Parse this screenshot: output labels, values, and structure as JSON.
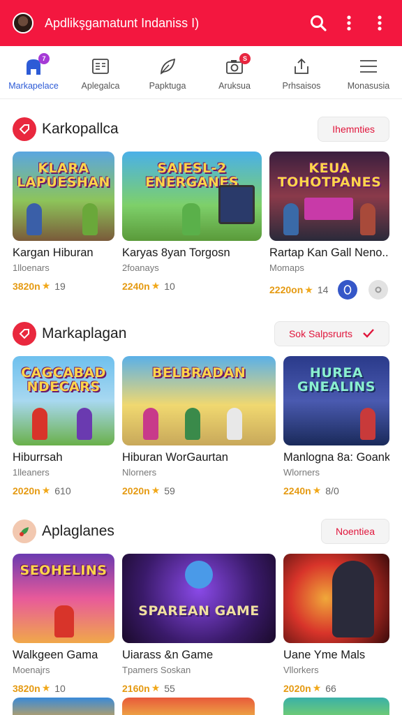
{
  "appbar": {
    "title": "Apdlikşgamatunt Indaniss I)",
    "icons": [
      "avatar",
      "search-icon",
      "more-vertical-icon",
      "more-vertical-icon"
    ],
    "color": "#f3173f"
  },
  "tabs": [
    {
      "label": "Markapelace",
      "icon": "store-icon",
      "active": true,
      "badge": "7"
    },
    {
      "label": "Aplegalca",
      "icon": "list-icon",
      "active": false
    },
    {
      "label": "Papktuga",
      "icon": "leaf-icon",
      "active": false
    },
    {
      "label": "Aruksua",
      "icon": "camera-icon",
      "active": false,
      "badge": "S"
    },
    {
      "label": "Prhsaisos",
      "icon": "share-icon",
      "active": false
    },
    {
      "label": "Monasusia",
      "icon": "menu-icon",
      "active": false
    }
  ],
  "sections": [
    {
      "title": "Karkopallca",
      "icon": "tag-icon",
      "button": "Ihemnties",
      "cards": [
        {
          "art": "KLARA LAPUESHAN",
          "title": "Kargan Hiburan",
          "sub": "1lloenars",
          "rating": "3820n",
          "count": "19"
        },
        {
          "art": "SAIESL-2 ENERGANES",
          "title": "Karyas 8yan Torgosn",
          "sub": "2foanays",
          "rating": "2240n",
          "count": "10"
        },
        {
          "art": "KEUA TOHOTPANES",
          "title": "Rartap Kan Gall Neno...",
          "sub": "Momaps",
          "rating": "2220on",
          "count": "14"
        }
      ]
    },
    {
      "title": "Markaplagan",
      "icon": "tag-icon",
      "button": "Sok Salpsrurts",
      "cards": [
        {
          "art": "CAGCABAD NDECARS",
          "title": "Hiburrsah",
          "sub": "1lleaners",
          "rating": "2020n",
          "count": "610"
        },
        {
          "art": "BELBRADAN",
          "title": "Hiburan WorGaurtan",
          "sub": "Nlorners",
          "rating": "2020n",
          "count": "59"
        },
        {
          "art": "HUREA GNEALINS",
          "title": "Manlogna 8a: Goank",
          "sub": "Wlorners",
          "rating": "2240n",
          "count": "8/0"
        }
      ]
    },
    {
      "title": "Aplaglanes",
      "icon": "leaf-icon",
      "button": "Noentiea",
      "cards": [
        {
          "art": "SEOHELINS",
          "title": "Walkgeen Gama",
          "sub": "Moenajrs",
          "rating": "3820n",
          "count": "10"
        },
        {
          "art": "SPAREAN GAME",
          "title": "Uiarass &n Game",
          "sub": "Tpamers Soskan",
          "rating": "2160n",
          "count": "55"
        },
        {
          "art": "",
          "title": "Uane Yme Mals",
          "sub": "Vllorkers",
          "rating": "2020n",
          "count": "66"
        }
      ]
    }
  ]
}
